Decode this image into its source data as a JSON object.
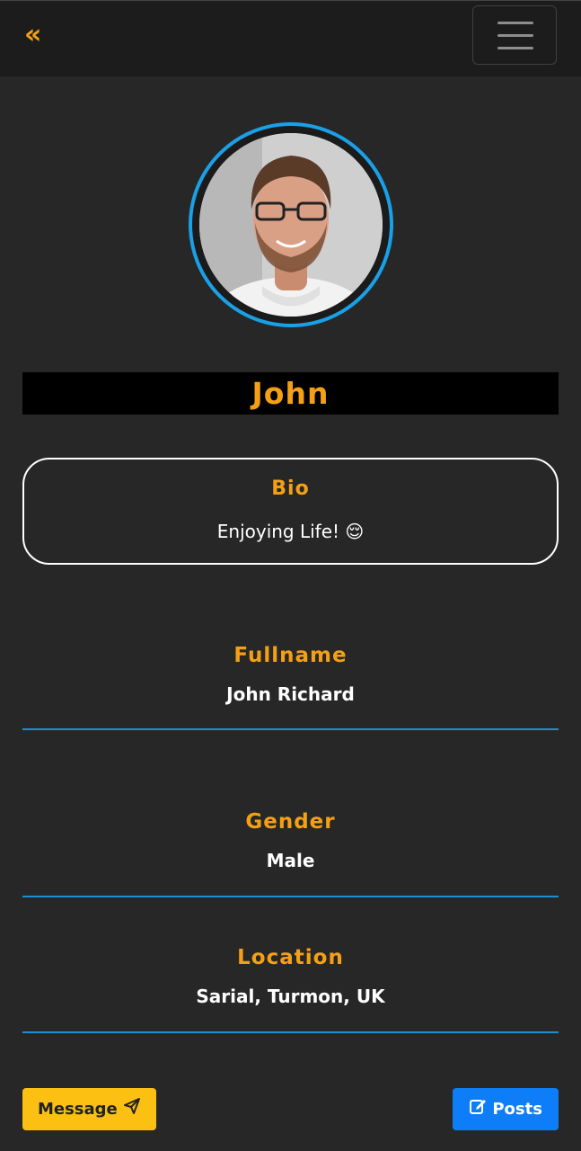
{
  "nav": {
    "back_label": "«"
  },
  "profile": {
    "name": "John",
    "bio_title": "Bio",
    "bio_text": "Enjoying Life! 😌",
    "fields": [
      {
        "label": "Fullname",
        "value": "John Richard"
      },
      {
        "label": "Gender",
        "value": "Male"
      },
      {
        "label": "Location",
        "value": "Sarial, Turmon, UK"
      }
    ]
  },
  "actions": {
    "message_label": "Message",
    "posts_label": "Posts"
  },
  "colors": {
    "accent": "#f3a017",
    "avatar_ring": "#1aa0e6",
    "divider": "#1a8fd6",
    "message_button": "#fcc012",
    "posts_button": "#0d7ef7",
    "background": "#272727"
  },
  "icons": {
    "back": "double-chevron-left-icon",
    "menu": "hamburger-menu-icon",
    "message": "paper-plane-icon",
    "posts": "edit-icon"
  }
}
